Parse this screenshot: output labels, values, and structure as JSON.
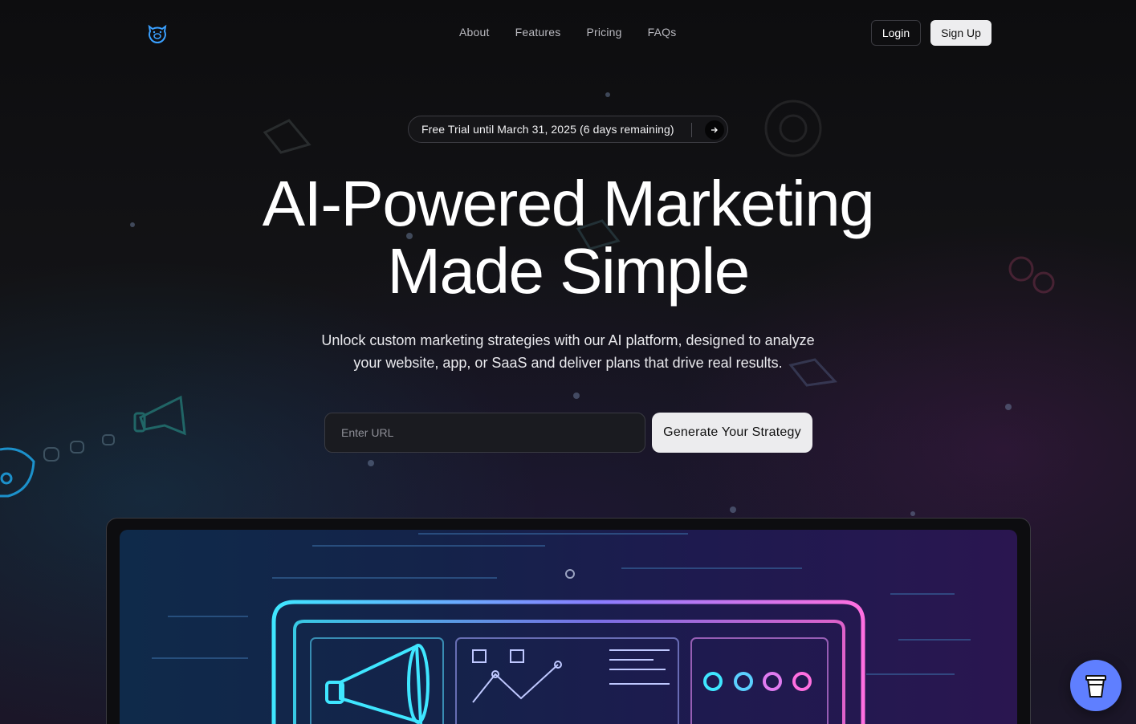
{
  "header": {
    "logo_icon": "pig-logo-icon",
    "nav": [
      {
        "label": "About"
      },
      {
        "label": "Features"
      },
      {
        "label": "Pricing"
      },
      {
        "label": "FAQs"
      }
    ],
    "login_label": "Login",
    "signup_label": "Sign Up"
  },
  "trial_banner": {
    "text": "Free Trial until March 31, 2025 (6 days remaining)",
    "arrow_icon": "arrow-right-icon"
  },
  "hero": {
    "title_line1": "AI-Powered Marketing",
    "title_line2": "Made Simple",
    "subtitle": "Unlock custom marketing strategies with our AI platform, designed to analyze your website, app, or SaaS and deliver plans that drive real results."
  },
  "form": {
    "url_placeholder": "Enter URL",
    "url_value": "",
    "generate_label": "Generate Your Strategy"
  },
  "floating_button": {
    "icon": "coffee-cup-icon"
  },
  "colors": {
    "background": "#0b0b0d",
    "accent_cyan": "#3fe6ff",
    "accent_pink": "#ff6fe0",
    "coffee_button": "#5f7fff"
  }
}
